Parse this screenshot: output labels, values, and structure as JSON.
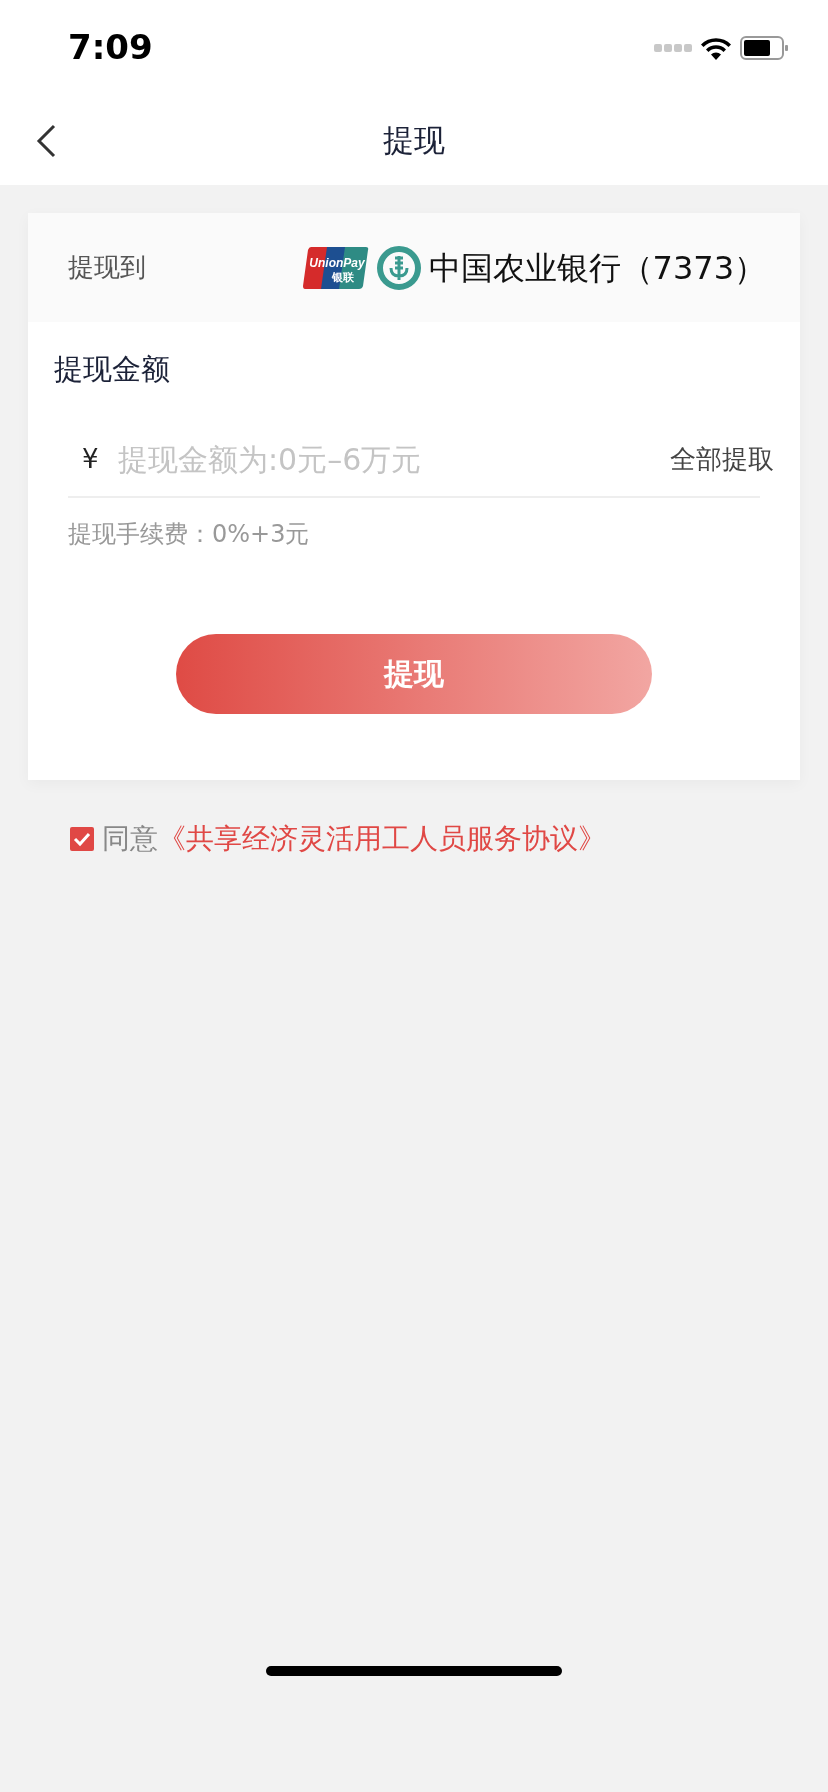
{
  "status_bar": {
    "time": "7:09"
  },
  "nav": {
    "title": "提现"
  },
  "withdraw_to": {
    "label": "提现到",
    "card_logo": {
      "text": "UnionPay",
      "subtext": "银联"
    },
    "bank_name": "中国农业银行（7373）"
  },
  "amount": {
    "heading": "提现金额",
    "currency": "¥",
    "placeholder": "提现金额为:0元–6万元",
    "all_link": "全部提取",
    "fee": "提现手续费：0%+3元"
  },
  "submit_button": "提现",
  "agreement": {
    "checked": true,
    "prefix": "同意",
    "link": "《共享经济灵活用工人员服务协议》"
  }
}
